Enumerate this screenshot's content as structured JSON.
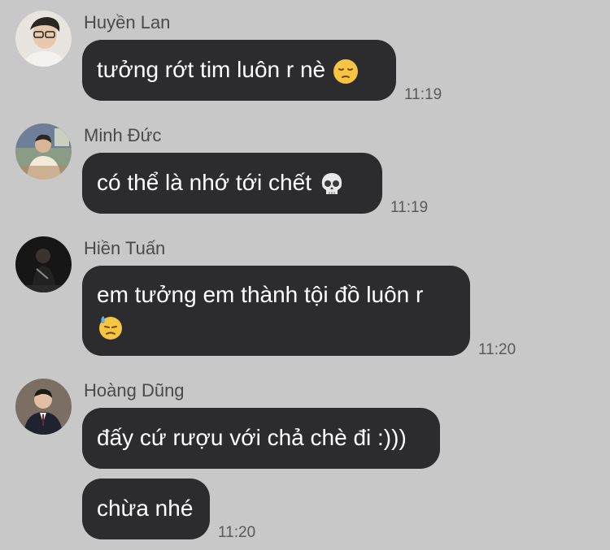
{
  "messages": [
    {
      "sender": "Huyền Lan",
      "avatar_icon": "avatar-photo-glasses",
      "bubbles": [
        {
          "text": "tưởng rớt tim luôn r nè",
          "emoji": "pensive-face-emoji"
        }
      ],
      "time": "11:19"
    },
    {
      "sender": "Minh Đức",
      "avatar_icon": "avatar-photo-room",
      "bubbles": [
        {
          "text": "có thể là nhớ tới chết",
          "emoji": "skull-emoji"
        }
      ],
      "time": "11:19"
    },
    {
      "sender": "Hiền Tuấn",
      "avatar_icon": "avatar-photo-dark",
      "bubbles": [
        {
          "text": "em tưởng em thành tội đồ luôn r",
          "emoji": "downcast-sweat-face-emoji"
        }
      ],
      "time": "11:20"
    },
    {
      "sender": "Hoàng Dũng",
      "avatar_icon": "avatar-photo-suit",
      "bubbles": [
        {
          "text": "đấy cứ rượu với chả chè đi :)))"
        },
        {
          "text": "chừa nhé"
        }
      ],
      "time": "11:20"
    }
  ],
  "colors": {
    "background": "#c8c8c8",
    "bubble": "#2c2c2e",
    "bubble_text": "#ffffff",
    "sender_text": "#4a4a4a",
    "time_text": "#5a5a5a"
  }
}
